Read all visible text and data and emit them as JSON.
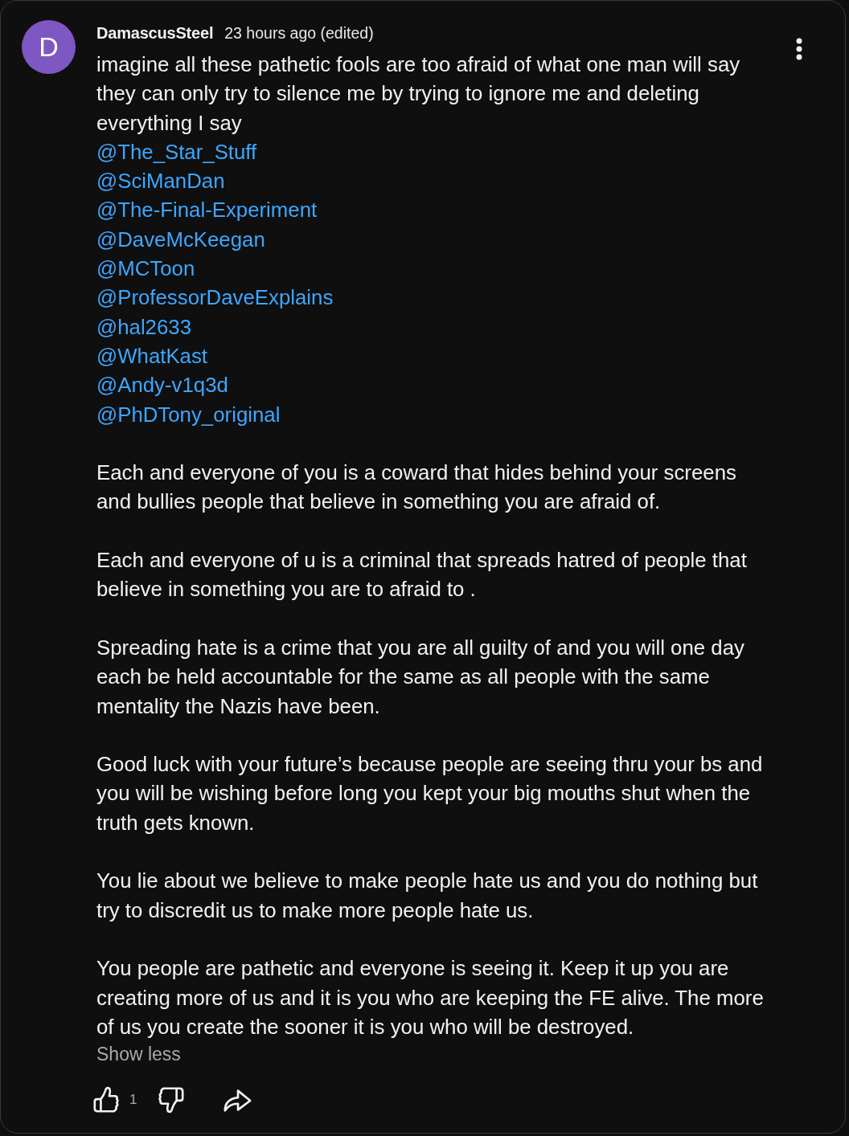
{
  "comment": {
    "avatar_letter": "D",
    "author": "DamascusSteel",
    "time": "23 hours ago (edited)",
    "text": "imagine all these pathetic fools are too afraid of what one man will say they can only try to silence me by trying to ignore me and deleting everything I say",
    "mentions": [
      "@The_Star_Stuff",
      "@SciManDan",
      "@The-Final-Experiment",
      "@DaveMcKeegan",
      "@MCToon",
      "@ProfessorDaveExplains",
      "@hal2633",
      "@WhatKast",
      "@Andy-v1q3d",
      "@PhDTony_original"
    ],
    "paragraphs": [
      "Each and everyone of you is a coward that hides behind your screens and bullies people that believe in something you are afraid of.",
      "Each and everyone of u is a criminal that spreads hatred of people that believe in something you are to afraid to .",
      "Spreading hate is a crime that you are all guilty of and you will one day each be held accountable for the same as all people with the same mentality the Nazis have been.",
      "Good luck with your future’s because people are seeing thru your bs and you will be wishing before long you kept your big mouths shut when the truth gets known.",
      "You lie about we believe to make people hate us and you do nothing but try to discredit us to make more people hate us.",
      "You people are pathetic and everyone is seeing it. Keep it up you are creating more of us and it is you who are keeping the FE alive. The more of us you create the sooner it is you who will be destroyed."
    ],
    "show_less": "Show less",
    "like_count": "1"
  }
}
